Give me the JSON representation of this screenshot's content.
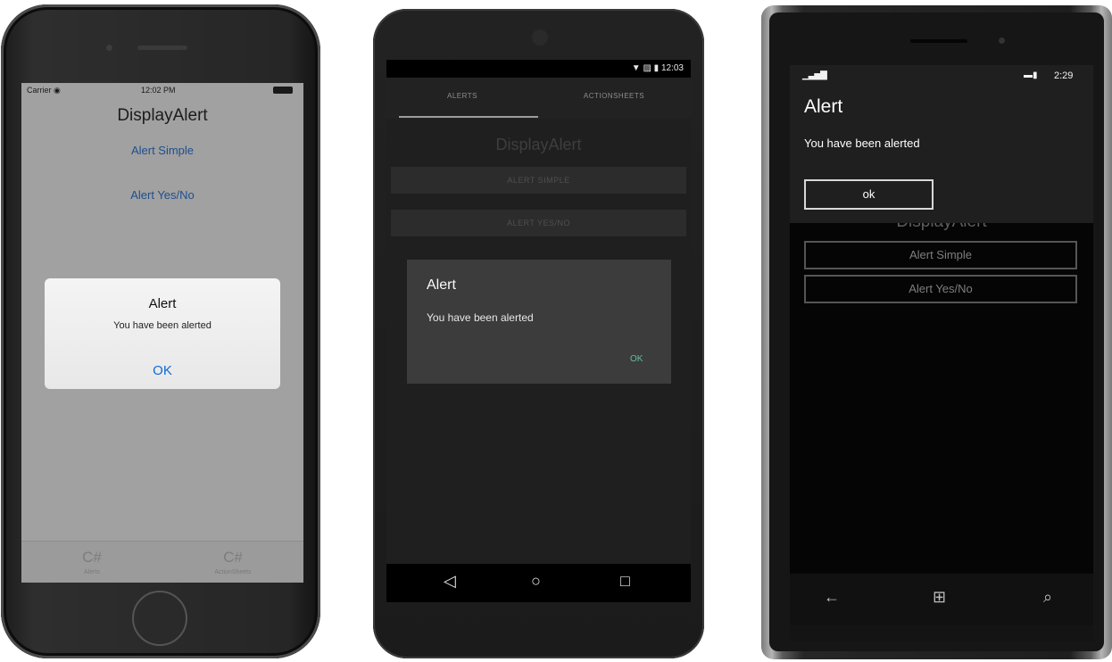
{
  "ios": {
    "status": {
      "carrier": "Carrier ◉",
      "time": "12:02 PM"
    },
    "page_title": "DisplayAlert",
    "buttons": {
      "alert_simple": "Alert Simple",
      "alert_yes_no": "Alert Yes/No"
    },
    "alert": {
      "title": "Alert",
      "message": "You have been alerted",
      "ok": "OK"
    },
    "tabs": [
      {
        "icon": "C#",
        "label": "Alerts"
      },
      {
        "icon": "C#",
        "label": "ActionSheets"
      }
    ]
  },
  "android": {
    "status": {
      "time": "12:03",
      "icons": "▼ ▨ ▮"
    },
    "tabs": [
      {
        "label": "ALERTS"
      },
      {
        "label": "ACTIONSHEETS"
      }
    ],
    "page_title": "DisplayAlert",
    "buttons": {
      "alert_simple": "ALERT SIMPLE",
      "alert_yes_no": "ALERT YES/NO"
    },
    "dialog": {
      "title": "Alert",
      "message": "You have been alerted",
      "ok": "OK"
    },
    "nav": {
      "back": "◁",
      "home": "○",
      "recents": "□"
    }
  },
  "winphone": {
    "status": {
      "signal": "▁▃▅▇",
      "battery": "▬▮",
      "time": "2:29"
    },
    "popup": {
      "title": "Alert",
      "message": "You have been alerted",
      "ok": "ok"
    },
    "page_title": "DisplayAlert",
    "buttons": {
      "alert_simple": "Alert Simple",
      "alert_yes_no": "Alert Yes/No"
    },
    "nav": {
      "back": "←",
      "start": "⊞",
      "search": "⌕"
    }
  }
}
